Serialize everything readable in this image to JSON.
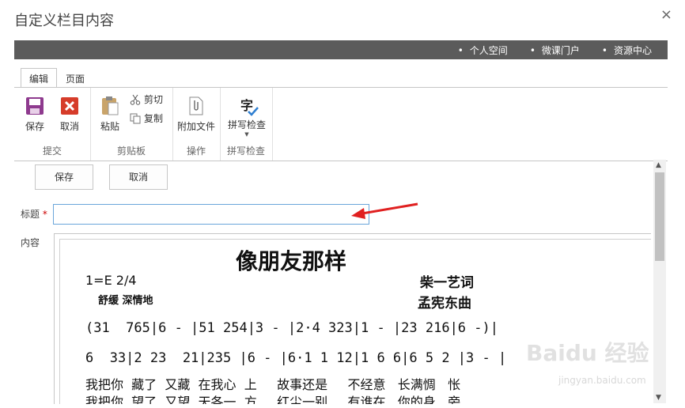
{
  "dialog": {
    "title": "自定义栏目内容",
    "close": "×"
  },
  "topnav": {
    "dot": "•",
    "links": [
      "个人空间",
      "微课门户",
      "资源中心"
    ]
  },
  "tabs": [
    "编辑",
    "页面"
  ],
  "ribbon": {
    "submit": {
      "label": "提交",
      "save": "保存",
      "cancel": "取消"
    },
    "clipboard": {
      "label": "剪贴板",
      "paste": "粘贴",
      "cut": "剪切",
      "copy": "复制"
    },
    "actions": {
      "label": "操作",
      "attach": "附加文件"
    },
    "spelling": {
      "label": "拼写检查",
      "check": "拼写检查",
      "glyph": "字"
    }
  },
  "form": {
    "save_button": "保存",
    "cancel_button": "取消",
    "title_label": "标题",
    "required_mark": "*",
    "title_value": "",
    "content_label": "内容"
  },
  "score": {
    "title": "像朋友那样",
    "key": "1=E  2/4",
    "lyricist": "柴一艺词",
    "mood": "舒缓  深情地",
    "composer": "孟宪东曲",
    "notes1": "(31  765|6 - |51 254|3 - |2·4 323|1 - |23 216|6 -)|",
    "notes2": "6  33|2 23  21|235 |6 - |6·1 1 12|1 6 6|6 5 2 |3 - |",
    "lyrics1": "我把你  藏了  又藏  在我心  上     故事还是     不经意   长满惆   怅",
    "lyrics2": "我把你  望了  又望  天各一  方     红尘一别     有谁在   你的身   旁"
  },
  "watermark": {
    "main": "Baidu 经验",
    "sub": "jingyan.baidu.com"
  },
  "colors": {
    "topbar": "#5b5b5b",
    "save_icon": "#8e3a8e",
    "cancel_icon": "#d63c2a",
    "input_border": "#6aa5da",
    "annotation_arrow": "#e02020"
  }
}
